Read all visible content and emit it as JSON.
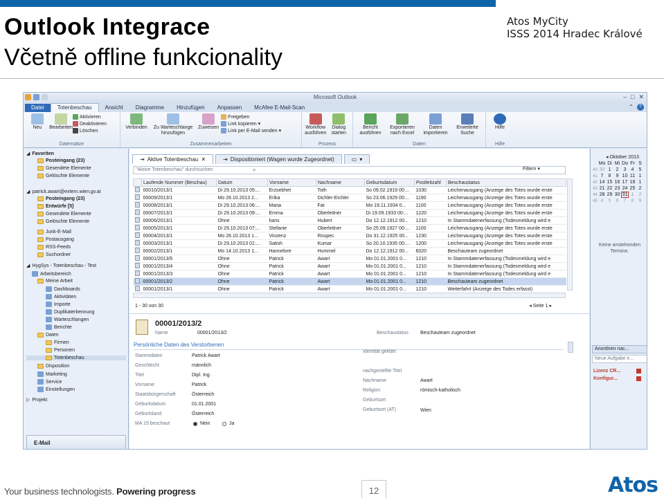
{
  "slide": {
    "title": "Outlook Integrace",
    "subtitle": "Včetně offline funkcionality",
    "brand_line1": "Atos MyCity",
    "brand_line2": "ISSS 2014 Hradec Králové",
    "footer_tagline_1": "Your business technologists.",
    "footer_tagline_2": "Powering progress",
    "page_number": "12",
    "logo": "Atos",
    "accent": "#0f63a8"
  },
  "window": {
    "title": "Microsoft Outlook"
  },
  "ribbon_tabs": [
    "Datei",
    "Totenbeschau",
    "Ansicht",
    "Diagramme",
    "Hinzufügen",
    "Anpassen",
    "McAfee E-Mail-Scan"
  ],
  "ribbon": {
    "groups": [
      {
        "label": "Datensätze",
        "buttons": [
          "Neu",
          "Bearbeiten"
        ],
        "small": [
          "Aktivieren",
          "Deaktivieren",
          "Löschen"
        ]
      },
      {
        "label": "Zusammenarbeiten",
        "buttons": [
          "Verbinden",
          "Zu Warteschlange hinzufügen",
          "Zuweisen"
        ],
        "small": [
          "Freigeben",
          "Link kopieren",
          "Link per E-Mail senden"
        ]
      },
      {
        "label": "Prozess",
        "buttons": [
          "Workflow ausführen",
          "Dialog starten"
        ]
      },
      {
        "label": "Daten",
        "buttons": [
          "Bericht ausführen",
          "Exportieren nach Excel",
          "Daten importieren",
          "Erweiterte Suche"
        ]
      },
      {
        "label": "Hilfe",
        "buttons": [
          "Hilfe"
        ]
      }
    ]
  },
  "nav": {
    "favorites_label": "Favoriten",
    "favorites": [
      "Posteingang (23)",
      "Gesendete Elemente",
      "Gelöschte Elemente"
    ],
    "account": "patrick.awart@extern.wien.gv.at",
    "account_items": [
      "Posteingang (23)",
      "Entwürfe [5]",
      "Gesendete Elemente",
      "Gelöschte Elemente",
      "Junk-E-Mail",
      "Postausgang",
      "RSS-Feeds",
      "Suchordner"
    ],
    "crm": "HygSys - Totenbeschau - Test",
    "crm_items": [
      "Arbeitsbereich",
      "Meine Arbeit",
      "Dashboards",
      "Aktivitäten",
      "Importe",
      "Duplikaterkennung",
      "Warteschlangen",
      "Berichte",
      "Daten",
      "Firmen",
      "Personen",
      "Totenbeschau",
      "Disposition",
      "Marketing",
      "Service",
      "Einstellungen"
    ],
    "projekt": "Projekt",
    "bottom": "E-Mail"
  },
  "views": {
    "active_tab": "Aktive Totenbeschau",
    "second_tab": "Dispositioniert (Wagen wurde Zugeordnet)",
    "search_placeholder": "\"Aktive Totenbeschau\" durchsuchen",
    "filter_label": "Filtern"
  },
  "grid": {
    "columns": [
      "Laufende Nummer (Beschau)",
      "Datum",
      "Vorname",
      "Nachname",
      "Geburtsdatum",
      "Postleitzahl",
      "Beschaustatus"
    ],
    "rows": [
      [
        "00010/2013/1",
        "Di 29.10.2013 05:...",
        "Erzsebhet",
        "Toth",
        "So 09.02.1919 00:...",
        "1030",
        "Leichenausgang (Anzeige des Totes wurde erste"
      ],
      [
        "00009/2013/1",
        "Mo 28.10.2013 2...",
        "Erika",
        "Dichler-Eichler",
        "So 23.06.1929 00:...",
        "1190",
        "Leichenausgang (Anzeige des Totes wurde erste"
      ],
      [
        "00008/2013/1",
        "Di 29.10.2013 06:...",
        "Maria",
        "Fat",
        "Mo 19.11.1934 0...",
        "1100",
        "Leichenausgang (Anzeige des Totes wurde erste"
      ],
      [
        "00007/2013/1",
        "Di 29.10.2013 09:...",
        "Emma",
        "Oberleitner",
        "Di 19.09.1933 00:...",
        "1220",
        "Leichenausgang (Anzeige des Totes wurde erste"
      ],
      [
        "00006/2013/1",
        "Ohne",
        "hans",
        "Hubert",
        "Do 12.12.1912 00...",
        "1210",
        "In Stammdatenerfassung (Todesmeldung wird e"
      ],
      [
        "00005/2013/1",
        "Di 29.10.2013 07:...",
        "Stefanie",
        "Oberleitner",
        "So 25.09.1927 00:...",
        "1100",
        "Leichenausgang (Anzeige des Totes wurde erste"
      ],
      [
        "00004/2013/1",
        "Mo 28.10.2013 1...",
        "Vinzenz",
        "Roupec",
        "Do 31.12.1925 00...",
        "1230",
        "Leichenausgang (Anzeige des Totes wurde erste"
      ],
      [
        "00003/2013/1",
        "Di 29.10.2013 01:...",
        "Satish",
        "Kumar",
        "So 20.10.1935 00:...",
        "1200",
        "Leichenausgang (Anzeige des Totes wurde erste"
      ],
      [
        "00002/2013/1",
        "Mo 14.10.2013 1...",
        "Hannelore",
        "Hummel",
        "Do 12.12.1912 00...",
        "6020",
        "Beschauteam zugeordnet"
      ],
      [
        "00001/2013/5",
        "Ohne",
        "Patrick",
        "Awart",
        "Mo 01.01.2001 0...",
        "1210",
        "In Stammdatenerfassung (Todesmeldung wird e"
      ],
      [
        "00001/2013/4",
        "Ohne",
        "Patrick",
        "Awart",
        "Mo 01.01.2001 0...",
        "1210",
        "In Stammdatenerfassung (Todesmeldung wird e"
      ],
      [
        "00001/2013/3",
        "Ohne",
        "Patrick",
        "Awart",
        "Mo 01.01.2001 0...",
        "1210",
        "In Stammdatenerfassung (Todesmeldung wird e"
      ],
      [
        "00001/2013/2",
        "Ohne",
        "Patrick",
        "Awart",
        "Mo 01.01.2001 0...",
        "1210",
        "Beschauteam zugeordnet"
      ],
      [
        "00001/2013/1",
        "Ohne",
        "Patrick",
        "Awart",
        "Mo 01.01.2001 0...",
        "1210",
        "Weiterfahrt (Anzeige des Todes erfasst)"
      ]
    ],
    "selected_row": 12,
    "pager_count": "1 - 30 von 30",
    "pager_page": "Seite 1"
  },
  "detail": {
    "record_title": "00001/2013/2",
    "name_label": "Name",
    "name_value": "00001/2013/2",
    "status_label": "Beschaustatus",
    "status_value": "Beschauteam zugeordnet",
    "section_title": "Persönliche Daten des Verstorbenen",
    "left_fields": [
      {
        "label": "Stammdaten",
        "value": "Patrick Awart"
      },
      {
        "label": "Geschlecht",
        "value": "männlich"
      },
      {
        "label": "Titel",
        "value": "Dipl. Ing."
      },
      {
        "label": "Vorname",
        "value": "Patrick"
      },
      {
        "label": "Staatsbürgerschaft",
        "value": "Österreich"
      },
      {
        "label": "Geburtsdatum",
        "value": "01.01.2001"
      },
      {
        "label": "Geburtsland",
        "value": "Österreich"
      }
    ],
    "ma15_label": "MA 15 beschaut",
    "ma15_no": "Nein",
    "ma15_yes": "Ja",
    "right_fields": [
      {
        "label": "Identität geklärt",
        "value": ""
      },
      {
        "label": "nachgestellte Titel",
        "value": ""
      },
      {
        "label": "Nachname",
        "value": "Awart"
      },
      {
        "label": "Religion",
        "value": "römisch-katholisch"
      },
      {
        "label": "Geburtsort",
        "value": ""
      },
      {
        "label": "Geburtsort (AT)",
        "value": "Wien"
      }
    ]
  },
  "todo": {
    "month": "Oktober 2013",
    "weekdays": [
      "Mo",
      "Di",
      "Mi",
      "Do",
      "Fr",
      "S"
    ],
    "weeks": [
      {
        "wk": "40",
        "days": [
          "30",
          "1",
          "2",
          "3",
          "4",
          "5"
        ]
      },
      {
        "wk": "41",
        "days": [
          "7",
          "8",
          "9",
          "10",
          "11",
          "1"
        ]
      },
      {
        "wk": "42",
        "days": [
          "14",
          "15",
          "16",
          "17",
          "18",
          "1"
        ]
      },
      {
        "wk": "43",
        "days": [
          "21",
          "22",
          "23",
          "24",
          "25",
          "2"
        ]
      },
      {
        "wk": "44",
        "days": [
          "28",
          "29",
          "30",
          "31",
          "1",
          "2"
        ]
      },
      {
        "wk": "45",
        "days": [
          "4",
          "5",
          "6",
          "7",
          "8",
          "9"
        ]
      }
    ],
    "no_appointments": "Keine anstehenden Termine.",
    "tasks_header": "Anordnen nac...",
    "task_placeholder": "Neue Aufgabe e...",
    "tasks": [
      "Lizenz CR...",
      "Konfigur..."
    ]
  }
}
